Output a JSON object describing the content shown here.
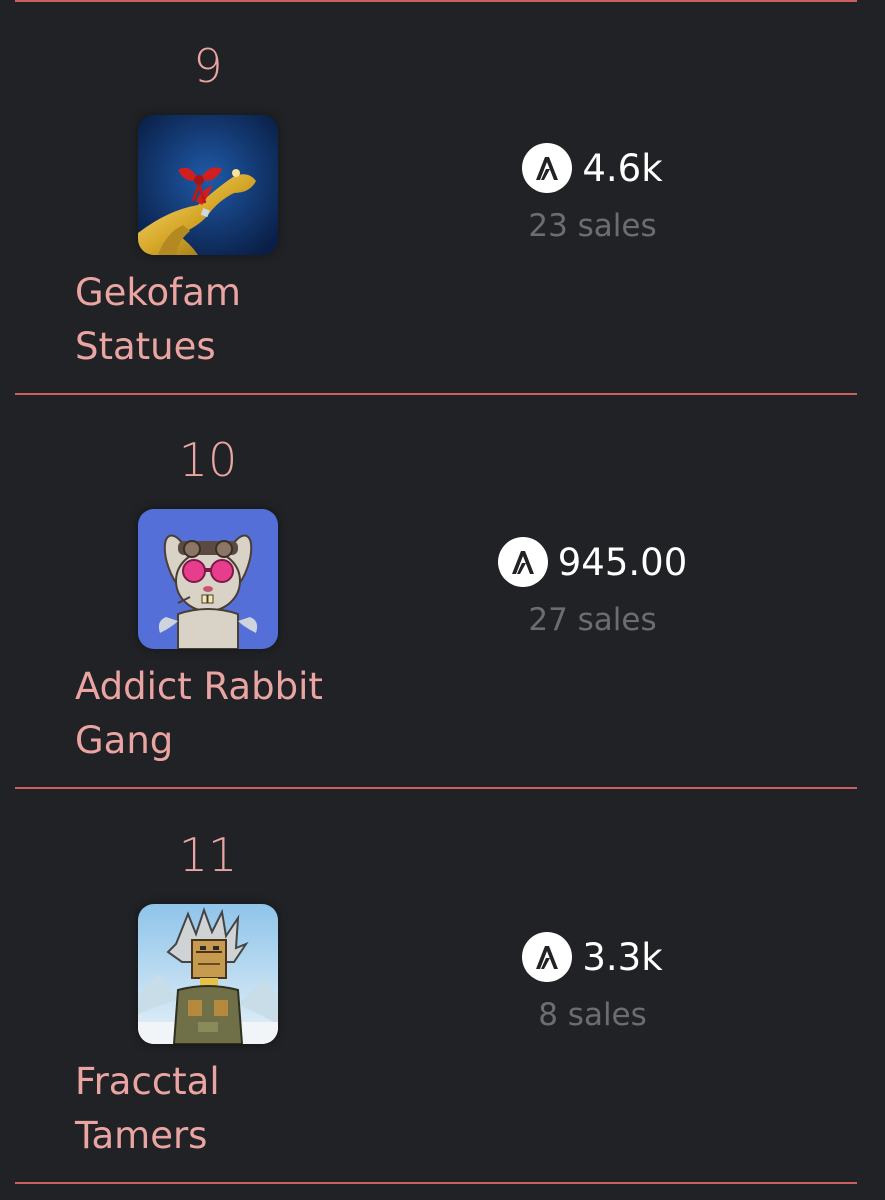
{
  "leaderboard": {
    "items": [
      {
        "rank": "9",
        "name_line1": "Gekofam",
        "name_line2": "Statues",
        "price": "4.6k",
        "sales": "23 sales",
        "thumb_icon": "golden-gecko-statue-image"
      },
      {
        "rank": "10",
        "name_line1": "Addict Rabbit",
        "name_line2": "Gang",
        "price": "945.00",
        "sales": "27 sales",
        "thumb_icon": "rabbit-with-goggles-image"
      },
      {
        "rank": "11",
        "name_line1": "Fracctal",
        "name_line2": "Tamers",
        "price": "3.3k",
        "sales": "8 sales",
        "thumb_icon": "wooden-mask-character-image"
      }
    ]
  },
  "colors": {
    "background": "#202226",
    "divider": "#c9615e",
    "accent_text": "#eaa5a2",
    "price_text": "#ffffff",
    "muted_text": "#6b6d70"
  },
  "currency_icon": "algorand-icon"
}
